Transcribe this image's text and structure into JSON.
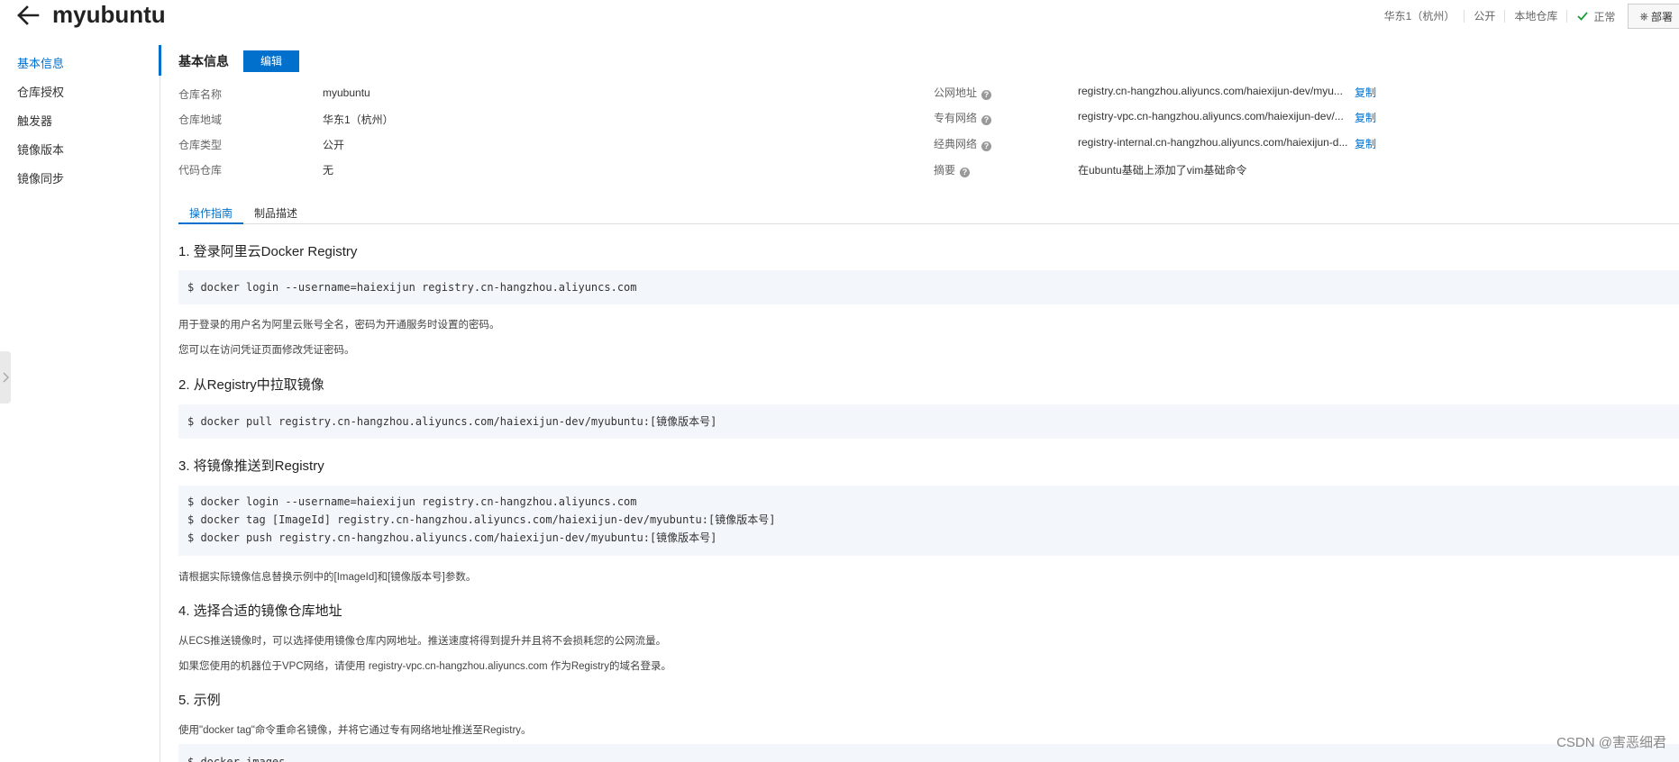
{
  "header": {
    "title": "myubuntu",
    "region": "华东1（杭州）",
    "visibility": "公开",
    "repo_kind": "本地仓库",
    "status": "正常",
    "deploy_label": "部署"
  },
  "sidebar": {
    "items": [
      {
        "label": "基本信息",
        "active": true
      },
      {
        "label": "仓库授权"
      },
      {
        "label": "触发器"
      },
      {
        "label": "镜像版本"
      },
      {
        "label": "镜像同步"
      }
    ]
  },
  "basic_info": {
    "section_title": "基本信息",
    "edit_label": "编辑",
    "left": [
      {
        "label": "仓库名称",
        "value": "myubuntu"
      },
      {
        "label": "仓库地域",
        "value": "华东1（杭州）"
      },
      {
        "label": "仓库类型",
        "value": "公开"
      },
      {
        "label": "代码仓库",
        "value": "无"
      }
    ],
    "right": [
      {
        "label": "公网地址",
        "value": "registry.cn-hangzhou.aliyuncs.com/haiexijun-dev/myu...",
        "copy": "复制"
      },
      {
        "label": "专有网络",
        "value": "registry-vpc.cn-hangzhou.aliyuncs.com/haiexijun-dev/...",
        "copy": "复制"
      },
      {
        "label": "经典网络",
        "value": "registry-internal.cn-hangzhou.aliyuncs.com/haiexijun-d...",
        "copy": "复制"
      },
      {
        "label": "摘要",
        "value": "在ubuntu基础上添加了vim基础命令"
      }
    ]
  },
  "tabs": [
    {
      "label": "操作指南",
      "active": true
    },
    {
      "label": "制品描述"
    }
  ],
  "guide": {
    "s1_title": "1. 登录阿里云Docker Registry",
    "s1_code": [
      "$ docker login --username=haiexijun registry.cn-hangzhou.aliyuncs.com"
    ],
    "s1_p1": "用于登录的用户名为阿里云账号全名，密码为开通服务时设置的密码。",
    "s1_p2": "您可以在访问凭证页面修改凭证密码。",
    "s2_title": "2. 从Registry中拉取镜像",
    "s2_code": [
      "$ docker pull registry.cn-hangzhou.aliyuncs.com/haiexijun-dev/myubuntu:[镜像版本号]"
    ],
    "s3_title": "3. 将镜像推送到Registry",
    "s3_code": [
      "$ docker login --username=haiexijun registry.cn-hangzhou.aliyuncs.com",
      "$ docker tag [ImageId] registry.cn-hangzhou.aliyuncs.com/haiexijun-dev/myubuntu:[镜像版本号]",
      "$ docker push registry.cn-hangzhou.aliyuncs.com/haiexijun-dev/myubuntu:[镜像版本号]"
    ],
    "s3_p1": "请根据实际镜像信息替换示例中的[ImageId]和[镜像版本号]参数。",
    "s4_title": "4. 选择合适的镜像仓库地址",
    "s4_p1": "从ECS推送镜像时，可以选择使用镜像仓库内网地址。推送速度将得到提升并且将不会损耗您的公网流量。",
    "s4_p2": "如果您使用的机器位于VPC网络，请使用 registry-vpc.cn-hangzhou.aliyuncs.com 作为Registry的域名登录。",
    "s5_title": "5. 示例",
    "s5_p1": "使用\"docker tag\"命令重命名镜像，并将它通过专有网络地址推送至Registry。",
    "s5_code": [
      "$ docker images"
    ]
  },
  "watermark": "CSDN @害恶细君"
}
